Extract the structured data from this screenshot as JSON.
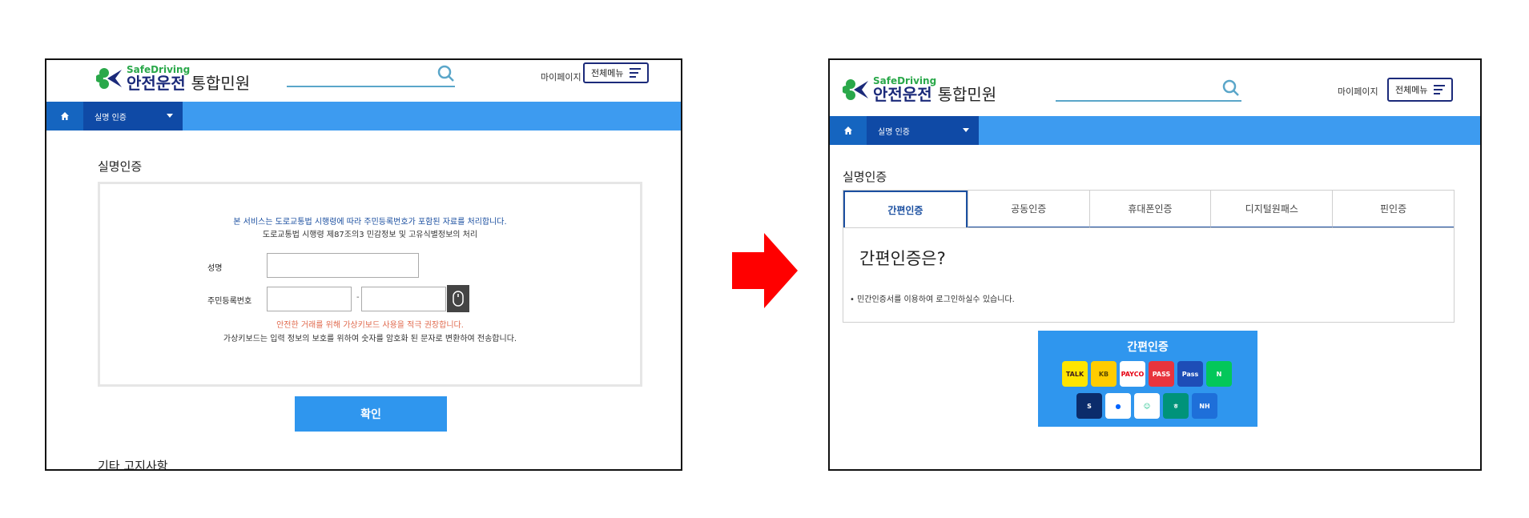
{
  "left_screen": {
    "logo": {
      "en": "SafeDriving",
      "ko_main": "안전운전",
      "ko_sub": "통합민원"
    },
    "header": {
      "mypage": "마이페이지",
      "allmenu": "전체메뉴"
    },
    "nav": {
      "dropdown": "실명 인증"
    },
    "section_title": "실명인증",
    "notice_line1": "본 서비스는 도로교통법 시행령에 따라 주민등록번호가 포함된 자료를 처리합니다.",
    "notice_line2": "도로교통법 시행령 제87조의3 민감정보 및 고유식별정보의 처리",
    "name_label": "성명",
    "rrn_label": "주민등록번호",
    "rrn_dash": "-",
    "warning": "안전한 거래를 위해 가상키보드 사용을 적극 권장합니다.",
    "info": "가상키보드는 입력 정보의 보호를 위하여 숫자를 암호화 된 문자로 변환하여 전송합니다.",
    "confirm_button": "확인",
    "other_notice": "기타 고지사항"
  },
  "right_screen": {
    "logo": {
      "en": "SafeDriving",
      "ko_main": "안전운전",
      "ko_sub": "통합민원"
    },
    "header": {
      "mypage": "마이페이지",
      "allmenu": "전체메뉴"
    },
    "nav": {
      "dropdown": "실명 인증"
    },
    "section_title": "실명인증",
    "tabs": [
      {
        "label": "간편인증",
        "active": true
      },
      {
        "label": "공동인증",
        "active": false
      },
      {
        "label": "휴대폰인증",
        "active": false
      },
      {
        "label": "디지털원패스",
        "active": false
      },
      {
        "label": "핀인증",
        "active": false
      }
    ],
    "content_title": "간편인증은?",
    "content_bullet": "• 민간인증서를 이용하여 로그인하실수 있습니다.",
    "easy_auth_title": "간편인증",
    "providers_row1": [
      {
        "name": "kakao-talk",
        "text": "TALK",
        "bg": "#fee500",
        "fg": "#3c1e1e"
      },
      {
        "name": "kb-bank",
        "text": "KB",
        "bg": "#ffcc00",
        "fg": "#5a4a00"
      },
      {
        "name": "payco",
        "text": "PAYCO",
        "bg": "#ffffff",
        "fg": "#e60012"
      },
      {
        "name": "pass",
        "text": "PASS",
        "bg": "#e8343d",
        "fg": "#ffffff"
      },
      {
        "name": "samsung-pass",
        "text": "Pass",
        "bg": "#1e4db7",
        "fg": "#ffffff"
      },
      {
        "name": "naver",
        "text": "N",
        "bg": "#03c75a",
        "fg": "#ffffff"
      }
    ],
    "providers_row2": [
      {
        "name": "shinhan-bank",
        "text": "S",
        "bg": "#0b2c6b",
        "fg": "#ffffff"
      },
      {
        "name": "toss",
        "text": "●",
        "bg": "#ffffff",
        "fg": "#0064ff"
      },
      {
        "name": "bank-salad",
        "text": "☺",
        "bg": "#ffffff",
        "fg": "#1cc08a"
      },
      {
        "name": "hana-bank",
        "text": "ㅎ",
        "bg": "#00937a",
        "fg": "#ffffff"
      },
      {
        "name": "nh-bank",
        "text": "NH",
        "bg": "#1e6fd9",
        "fg": "#ffffff"
      }
    ]
  },
  "colors": {
    "nav": "#3d9bf0",
    "nav_dark": "#0f4aa6",
    "button": "#2f96ee",
    "arrow": "#ff0000",
    "brand": "#1b2a7a"
  }
}
